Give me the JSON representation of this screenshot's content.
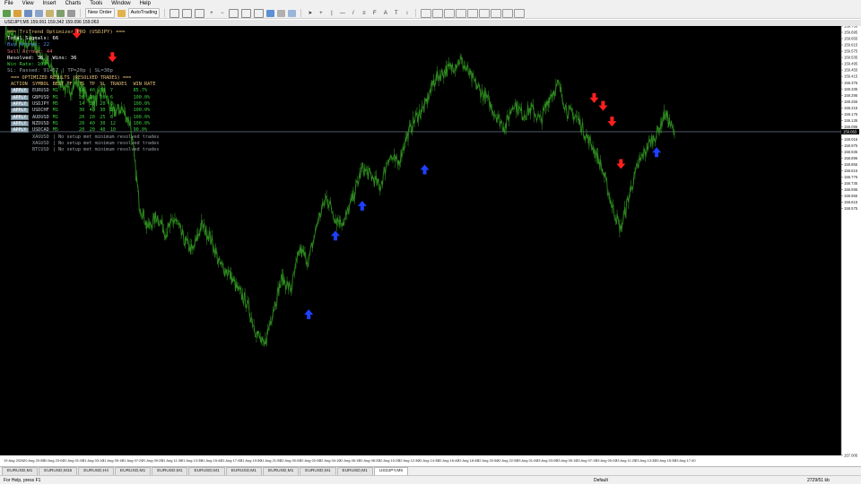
{
  "menu": {
    "items": [
      "File",
      "View",
      "Insert",
      "Charts",
      "Tools",
      "Window",
      "Help"
    ]
  },
  "toolbar": {
    "new_order": "New Order",
    "autotrading": "AutoTrading",
    "zoom_in_symbol": "+",
    "zoom_out_symbol": "−"
  },
  "chart_window": {
    "title": "USDJPY,M5  159.061 159.342 159.096 159.063"
  },
  "indicator": {
    "lines": [
      {
        "text": "=== TriTrend Optimizer PRO (USDJPY) ===",
        "color": "#e5c07b"
      },
      {
        "text": "Total Signals: 66",
        "color": "#ffffff"
      },
      {
        "text": "Buy Arrows: 22",
        "color": "#4f8ce8"
      },
      {
        "text": "Sell Arrows: 44",
        "color": "#e06c75"
      },
      {
        "text": "Resolved: 36 | Wins: 36",
        "color": "#ffffff"
      },
      {
        "text": "Win Rate: 100%",
        "color": "#3ccc3c"
      },
      {
        "text": "SL: Passed: 91+57 | TP=20p | SL=30p",
        "color": "#9aa0a6"
      }
    ],
    "results_title": "=== OPTIMIZED RESULTS (RESOLVED TRADES) ===",
    "headers": [
      "ACTION",
      "SYMBOL",
      "BEST TF",
      "TS",
      "TP",
      "SL",
      "TRADES",
      "WIN RATE"
    ],
    "rows": [
      [
        "APPLY",
        "EURUSD",
        "M1",
        "14",
        "40",
        "30",
        "7",
        "85.7%"
      ],
      [
        "APPLY",
        "GBPUSD",
        "M1",
        "20",
        "20",
        "20",
        "6",
        "100.0%"
      ],
      [
        "APPLY",
        "USDJPY",
        "M5",
        "14",
        "30",
        "20",
        "8",
        "100.0%"
      ],
      [
        "APPLY",
        "USDCHF",
        "M1",
        "30",
        "40",
        "30",
        "11",
        "100.0%"
      ],
      [
        "APPLY",
        "AUDUSD",
        "M1",
        "20",
        "20",
        "25",
        "6",
        "100.0%"
      ],
      [
        "APPLY",
        "NZDUSD",
        "M1",
        "20",
        "40",
        "30",
        "12",
        "100.0%"
      ],
      [
        "APPLY",
        "USDCAD",
        "M5",
        "20",
        "20",
        "40",
        "10",
        "90.0%"
      ]
    ],
    "no_setup": [
      [
        "XAUUSD",
        "| No setup met minimum resolved trades"
      ],
      [
        "XAGUSD",
        "| No setup met minimum resolved trades"
      ],
      [
        "BTCUSD",
        "| No setup met minimum resolved trades"
      ]
    ]
  },
  "chart_data": {
    "type": "line",
    "symbol": "USDJPY",
    "timeframe": "M5",
    "ylim": [
      157.005,
      159.735
    ],
    "y_ticks": [
      159.735,
      159.695,
      159.655,
      159.615,
      159.575,
      159.535,
      159.495,
      159.455,
      159.415,
      159.375,
      159.335,
      159.295,
      159.255,
      159.215,
      159.175,
      159.135,
      159.095,
      159.055,
      159.015,
      158.975,
      158.935,
      158.895,
      158.855,
      158.815,
      158.775,
      158.735,
      158.695,
      158.655,
      158.615,
      158.575,
      157.005
    ],
    "current_price": "159.063",
    "current_price_value": 159.063,
    "x_labels": [
      "19 Aug 2026",
      "20 Aug 20:55",
      "20 Aug 23:00",
      "21 Aug 01:05",
      "21 Aug 03:10",
      "21 Aug 05:15",
      "21 Aug 07:20",
      "21 Aug 09:25",
      "21 Aug 11:30",
      "21 Aug 13:35",
      "21 Aug 15:40",
      "21 Aug 17:45",
      "21 Aug 19:50",
      "21 Aug 21:55",
      "22 Aug 00:00",
      "22 Aug 02:05",
      "22 Aug 04:10",
      "22 Aug 06:15",
      "22 Aug 08:20",
      "22 Aug 10:25",
      "22 Aug 12:30",
      "22 Aug 14:35",
      "22 Aug 16:40",
      "22 Aug 18:45",
      "22 Aug 20:50",
      "22 Aug 22:55",
      "23 Aug 01:00",
      "23 Aug 03:05",
      "23 Aug 05:10",
      "23 Aug 07:15",
      "23 Aug 09:20",
      "23 Aug 11:25",
      "23 Aug 13:30",
      "23 Aug 15:35",
      "23 Aug 17:40"
    ],
    "series": [
      {
        "color": "#2e8b1f",
        "values": [
          159.7,
          159.66,
          159.61,
          159.64,
          159.55,
          159.47,
          159.4,
          159.31,
          159.38,
          159.3,
          159.25,
          159.33,
          159.18,
          159.21,
          159.12,
          158.61,
          158.45,
          158.53,
          158.42,
          158.51,
          158.38,
          158.3,
          158.47,
          158.39,
          158.22,
          158.17,
          158.06,
          157.98,
          157.81,
          157.69,
          157.93,
          158.13,
          158.06,
          158.31,
          158.24,
          158.49,
          158.65,
          158.51,
          158.49,
          158.65,
          158.83,
          158.78,
          158.71,
          158.91,
          158.86,
          159.03,
          159.15,
          159.22,
          159.38,
          159.44,
          159.47,
          159.52,
          159.43,
          159.34,
          159.27,
          159.17,
          159.09,
          159.25,
          159.17,
          159.21,
          159.13,
          159.29,
          159.36,
          159.19,
          159.16,
          159.05,
          158.95,
          158.81,
          158.59,
          158.44,
          158.68,
          158.86,
          158.97,
          159.05,
          159.18,
          159.05
        ]
      }
    ],
    "buy_arrows": [
      {
        "i": 34,
        "y": 157.9
      },
      {
        "i": 37,
        "y": 158.4
      },
      {
        "i": 40,
        "y": 158.59
      },
      {
        "i": 47,
        "y": 158.82
      },
      {
        "i": 73,
        "y": 158.93
      }
    ],
    "sell_arrows": [
      {
        "i": 8,
        "y": 159.69
      },
      {
        "i": 12,
        "y": 159.54
      },
      {
        "i": 66,
        "y": 159.28
      },
      {
        "i": 67,
        "y": 159.23
      },
      {
        "i": 68,
        "y": 159.13
      },
      {
        "i": 69,
        "y": 158.86
      }
    ]
  },
  "tabs": {
    "items": [
      "EURUSD,M1",
      "EURUSD,M15",
      "EURUSD,H4",
      "EURUSD,M1",
      "EURUSD,M1",
      "EURUSD,M1",
      "EURUSD,M1",
      "EURUSD,M1",
      "EURUSD,M1",
      "EURUSD,M1",
      "USDJPY,M5"
    ],
    "active_index": 10
  },
  "status": {
    "help": "For Help, press F1",
    "profile": "Default",
    "connection": "2729/51 kb"
  }
}
